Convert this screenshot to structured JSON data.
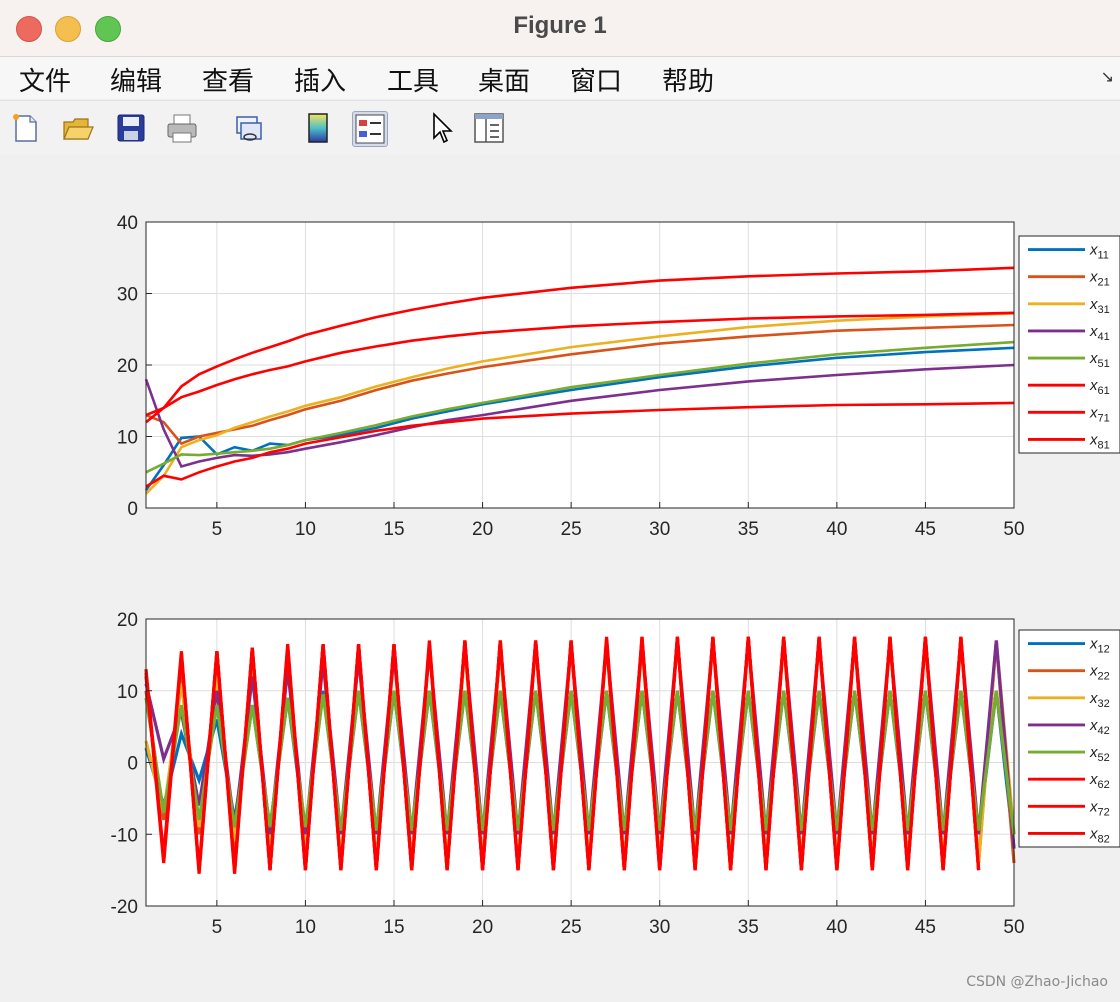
{
  "window": {
    "title": "Figure 1"
  },
  "menubar": {
    "items": [
      "文件",
      "编辑",
      "查看",
      "插入",
      "工具",
      "桌面",
      "窗口",
      "帮助"
    ]
  },
  "toolbar": {
    "icons": [
      "new-figure-icon",
      "open-file-icon",
      "save-icon",
      "print-icon",
      "link-plot-icon",
      "colorbar-icon",
      "legend-icon",
      "pointer-icon",
      "property-inspector-icon"
    ]
  },
  "watermark": "CSDN @Zhao-Jichao",
  "colors": {
    "blue": "#0072bd",
    "orange": "#d95319",
    "yellow": "#edb120",
    "purple": "#7e2f8e",
    "green": "#77ac30",
    "red": "#ff0000"
  },
  "chart_data": [
    {
      "type": "line",
      "title": "",
      "xlim": [
        1,
        50
      ],
      "ylim": [
        0,
        40
      ],
      "xticks": [
        5,
        10,
        15,
        20,
        25,
        30,
        35,
        40,
        45,
        50
      ],
      "yticks": [
        0,
        10,
        20,
        30,
        40
      ],
      "grid": true,
      "legend": "outside-right",
      "x": [
        1,
        2,
        3,
        4,
        5,
        6,
        7,
        8,
        9,
        10,
        12,
        14,
        16,
        18,
        20,
        25,
        30,
        35,
        40,
        45,
        50
      ],
      "series": [
        {
          "name": "x11",
          "color": "blue",
          "values": [
            2.5,
            6,
            9.8,
            10,
            7.5,
            8.5,
            8,
            9,
            8.8,
            9.5,
            10.2,
            11.2,
            12.5,
            13.5,
            14.5,
            16.5,
            18.3,
            19.8,
            21,
            21.8,
            22.4
          ]
        },
        {
          "name": "x21",
          "color": "orange",
          "values": [
            13,
            12,
            9,
            10,
            10.5,
            11,
            11.5,
            12.3,
            13,
            13.8,
            15,
            16.5,
            17.8,
            18.8,
            19.7,
            21.5,
            23,
            24,
            24.8,
            25.2,
            25.6
          ]
        },
        {
          "name": "x31",
          "color": "yellow",
          "values": [
            2,
            4.5,
            8.5,
            9.5,
            10.2,
            11.2,
            12,
            12.8,
            13.5,
            14.3,
            15.5,
            17,
            18.3,
            19.5,
            20.5,
            22.5,
            24,
            25.3,
            26.2,
            26.8,
            27.2
          ]
        },
        {
          "name": "x41",
          "color": "purple",
          "values": [
            18,
            11,
            5.8,
            6.5,
            7,
            7.4,
            7.3,
            7.5,
            7.8,
            8.3,
            9.2,
            10.2,
            11.3,
            12.3,
            13,
            15,
            16.5,
            17.7,
            18.6,
            19.4,
            20
          ]
        },
        {
          "name": "x51",
          "color": "green",
          "values": [
            5,
            6.2,
            7.5,
            7.4,
            7.6,
            7.8,
            8,
            8.3,
            8.8,
            9.5,
            10.5,
            11.6,
            12.8,
            13.8,
            14.7,
            16.9,
            18.6,
            20.2,
            21.5,
            22.4,
            23.2
          ]
        },
        {
          "name": "x61",
          "color": "red",
          "values": [
            3,
            4.5,
            4,
            5,
            5.8,
            6.5,
            7,
            7.8,
            8.3,
            9,
            9.9,
            10.8,
            11.5,
            12,
            12.5,
            13.2,
            13.7,
            14.1,
            14.4,
            14.5,
            14.7
          ]
        },
        {
          "name": "x71",
          "color": "red",
          "values": [
            13,
            14,
            15.5,
            16.3,
            17.2,
            18,
            18.7,
            19.3,
            19.8,
            20.5,
            21.7,
            22.6,
            23.4,
            24,
            24.5,
            25.4,
            26,
            26.5,
            26.8,
            27,
            27.3
          ]
        },
        {
          "name": "x81",
          "color": "red",
          "values": [
            12,
            14,
            17,
            18.7,
            19.8,
            20.8,
            21.7,
            22.5,
            23.3,
            24.2,
            25.5,
            26.7,
            27.7,
            28.6,
            29.4,
            30.8,
            31.8,
            32.4,
            32.8,
            33.1,
            33.6
          ]
        }
      ]
    },
    {
      "type": "line",
      "title": "",
      "xlim": [
        1,
        50
      ],
      "ylim": [
        -20,
        20
      ],
      "xticks": [
        5,
        10,
        15,
        20,
        25,
        30,
        35,
        40,
        45,
        50
      ],
      "yticks": [
        -20,
        -10,
        0,
        10,
        20
      ],
      "grid": true,
      "legend": "outside-right",
      "x": [
        1,
        2,
        3,
        4,
        5,
        6,
        7,
        8,
        9,
        10,
        11,
        12,
        13,
        14,
        15,
        16,
        17,
        18,
        19,
        20,
        21,
        22,
        23,
        24,
        25,
        26,
        27,
        28,
        29,
        30,
        31,
        32,
        33,
        34,
        35,
        36,
        37,
        38,
        39,
        40,
        41,
        42,
        43,
        44,
        45,
        46,
        47,
        48,
        49,
        50
      ],
      "series": [
        {
          "name": "x12",
          "color": "blue",
          "values": [
            2,
            -6,
            4,
            -2.5,
            6,
            -8,
            8,
            -9,
            9,
            -10,
            10,
            -10,
            10,
            -10,
            10,
            -10,
            10,
            -10,
            10,
            -10,
            10,
            -10,
            10,
            -10,
            10,
            -10,
            10,
            -10,
            10,
            -10,
            10,
            -10,
            10,
            -10,
            10,
            -10,
            10,
            -10,
            10,
            -10,
            10,
            -10,
            10,
            -10,
            10,
            -10,
            10,
            -10,
            10,
            -12
          ]
        },
        {
          "name": "x22",
          "color": "orange",
          "values": [
            10,
            -8,
            12,
            -10,
            13,
            -12,
            14,
            -13,
            14.5,
            -13.5,
            15,
            -14,
            15.5,
            -14,
            15.5,
            -14,
            16,
            -14,
            16,
            -14,
            16,
            -14,
            16.5,
            -14,
            16.5,
            -14,
            16.5,
            -14,
            16.5,
            -14,
            17,
            -14,
            17,
            -14,
            17,
            -14,
            17,
            -14,
            17,
            -14,
            17,
            -14,
            17,
            -14,
            17,
            -14,
            17,
            -14,
            17,
            -14
          ]
        },
        {
          "name": "x32",
          "color": "yellow",
          "values": [
            3,
            -7,
            11,
            -9,
            12,
            -11,
            13,
            -12,
            14,
            -13,
            14.5,
            -13.5,
            15,
            -14,
            15.5,
            -14,
            16,
            -14,
            16,
            -14,
            16,
            -14,
            16.5,
            -14,
            16.5,
            -14,
            16.5,
            -14,
            16.5,
            -14,
            17,
            -14,
            17,
            -14,
            17,
            -14,
            17,
            -14,
            17,
            -14,
            17,
            -14,
            17,
            -14,
            17,
            -14,
            17,
            -14,
            17,
            -10
          ]
        },
        {
          "name": "x42",
          "color": "purple",
          "values": [
            11,
            0.5,
            7,
            -6,
            10,
            -9,
            12,
            -10,
            13,
            -10,
            14,
            -10,
            14.5,
            -10,
            15,
            -10,
            15.5,
            -10,
            16,
            -10,
            16,
            -10,
            16.5,
            -10,
            16.5,
            -10,
            16.5,
            -10,
            16.5,
            -10,
            17,
            -10,
            17,
            -10,
            17,
            -10,
            17,
            -10,
            17,
            -10,
            17,
            -10,
            17,
            -10,
            17,
            -10,
            17,
            -10,
            17,
            -12
          ]
        },
        {
          "name": "x52",
          "color": "green",
          "values": [
            9,
            -7,
            8,
            -8,
            8,
            -9,
            8,
            -9,
            9,
            -9,
            9.5,
            -9.5,
            10,
            -9.5,
            10,
            -9.5,
            10,
            -9.5,
            10,
            -9.5,
            10,
            -9.5,
            10,
            -9.5,
            10,
            -9.5,
            10,
            -9.5,
            10,
            -9.5,
            10,
            -9.5,
            10,
            -9.5,
            10,
            -9.5,
            10,
            -9.5,
            10,
            -9.5,
            10,
            -9.5,
            10,
            -9.5,
            10,
            -9.5,
            10,
            -9.5,
            10,
            -10
          ]
        },
        {
          "name": "x62",
          "color": "red",
          "values": [
            13,
            -13.5,
            15,
            -15,
            15.5,
            -15,
            16,
            -15,
            16,
            -15,
            16.5,
            -15,
            16.5,
            -15,
            16.5,
            -15,
            16.5,
            -15,
            17,
            -15,
            17,
            -15,
            17,
            -15,
            17,
            -15,
            17,
            -15,
            17,
            -15,
            17.5,
            -15,
            17.5,
            -15,
            17.5,
            -15,
            17.5,
            -15,
            17.5,
            -15,
            17.5,
            -15,
            17.5,
            -15,
            17.5,
            -15,
            17.5,
            -15
          ]
        },
        {
          "name": "x72",
          "color": "red",
          "values": [
            12,
            -13,
            15.5,
            -15.5,
            15.5,
            -15.5,
            16,
            -15,
            16.5,
            -15,
            16.5,
            -15,
            16.5,
            -15,
            16.5,
            -15,
            17,
            -15,
            17,
            -15,
            17,
            -15,
            17,
            -15,
            17,
            -15,
            17.5,
            -15,
            17.5,
            -15,
            17.5,
            -15,
            17.5,
            -15,
            17.5,
            -15,
            17.5,
            -15,
            17.5,
            -15,
            17.5,
            -15,
            17.5,
            -15,
            17.5,
            -15,
            17.5,
            -15
          ]
        },
        {
          "name": "x82",
          "color": "red",
          "values": [
            12.5,
            -14,
            15,
            -15,
            15.5,
            -15,
            16,
            -15,
            16,
            -15,
            16.5,
            -15,
            16.5,
            -15,
            16.5,
            -15,
            16.5,
            -15,
            17,
            -15,
            17,
            -15,
            17,
            -15,
            17,
            -15,
            17,
            -15,
            17.5,
            -15,
            17.5,
            -15,
            17.5,
            -15,
            17.5,
            -15,
            17.5,
            -15,
            17.5,
            -15,
            17.5,
            -15,
            17.5,
            -15,
            17.5,
            -15,
            17.5,
            -15
          ]
        }
      ]
    }
  ]
}
